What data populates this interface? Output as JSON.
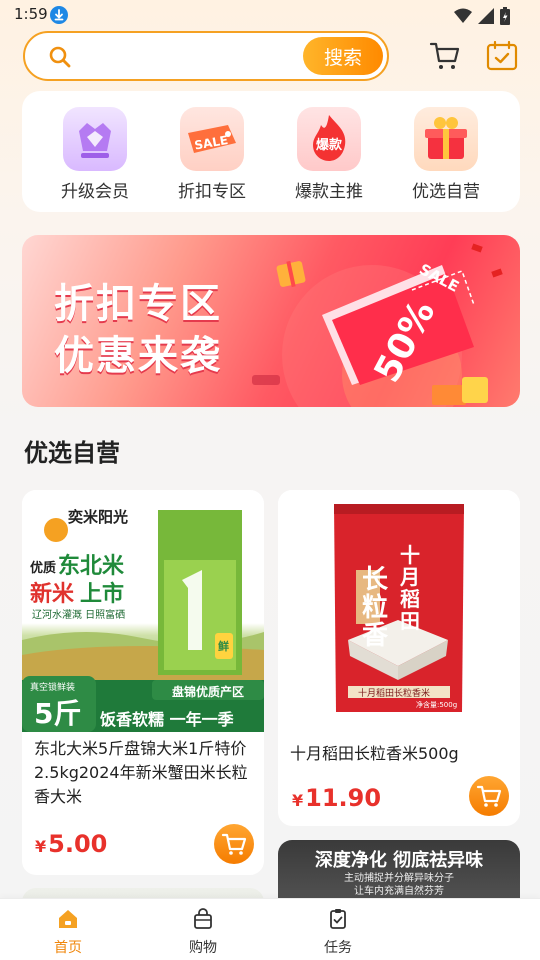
{
  "status_bar": {
    "time": "1:59"
  },
  "search": {
    "placeholder": "",
    "button_label": "搜索"
  },
  "categories": [
    {
      "label": "升级会员",
      "icon": "diamond-crown-icon"
    },
    {
      "label": "折扣专区",
      "icon": "sale-tag-icon",
      "badge": "SALE"
    },
    {
      "label": "爆款主推",
      "icon": "hot-fire-icon",
      "badge": "爆款"
    },
    {
      "label": "优选自营",
      "icon": "gift-box-icon"
    }
  ],
  "banner": {
    "line1": "折扣专区",
    "line2": "优惠来袭",
    "tag_sale": "SALE",
    "tag_percent": "50%"
  },
  "section_title": "优选自营",
  "products": [
    {
      "name": "东北大米5斤盘锦大米1斤特价2.5kg2024年新米蟹田米长粒香大米",
      "currency": "¥",
      "price": "5.00",
      "image_text": {
        "brand": "奕米阳光",
        "q1": "优质",
        "q2": "东北米",
        "q3": "新米",
        "q4": "上市",
        "sub": "辽河水灌溉 日照富硒",
        "pack": "真空锁鲜装",
        "weight": "5斤",
        "tag1": "饭香软糯 一年一季",
        "tag2": "盘锦优质产区",
        "fresh": "鲜"
      }
    },
    {
      "name": "十月稻田长粒香米500g",
      "currency": "¥",
      "price": "11.90",
      "image_text": {
        "vertical1": "十月稻田",
        "vertical2": "长粒香",
        "label": "十月稻田长粒香米",
        "weight": "净含量:500g"
      }
    }
  ],
  "promo": {
    "headline": "深度净化 彻底祛异味",
    "sub1": "主动捕捉并分解异味分子",
    "sub2": "让车内充满自然芬芳"
  },
  "bottom_nav": [
    {
      "label": "首页",
      "icon": "home-icon",
      "active": true
    },
    {
      "label": "购物",
      "icon": "shopping-bag-icon",
      "active": false
    },
    {
      "label": "任务",
      "icon": "task-clipboard-icon",
      "active": false
    }
  ],
  "colors": {
    "accent": "#f5a122",
    "price": "#e8312b",
    "banner": "#ff4d5e",
    "active_nav": "#f0860a"
  }
}
